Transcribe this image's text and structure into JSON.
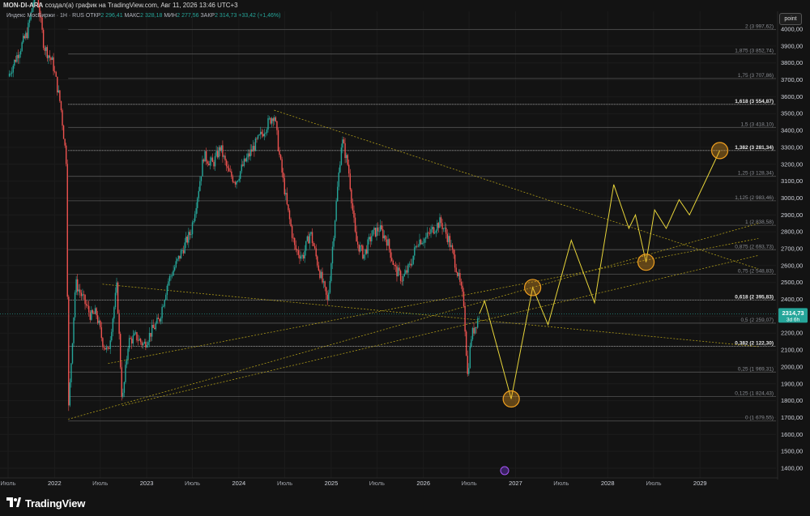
{
  "header": {
    "author": "MON-DI-ARA",
    "created_text": "создал(а) график на TradingView.com, Авг 11, 2026 13:46 UTC+3"
  },
  "legend": {
    "symbol": "Индекс МосБиржи · 1Н · RUS",
    "open_label": "ОТКР",
    "open": "2 296,41",
    "high_label": "МАКС",
    "high": "2 328,18",
    "low_label": "МИН",
    "low": "2 277,56",
    "close_label": "ЗАКР",
    "close": "2 314,73",
    "change": "+33,42 (+1,46%)"
  },
  "scale_button": "point",
  "brand": {
    "name": "TradingView"
  },
  "colors": {
    "background": "#131313",
    "up": "#26a69a",
    "down": "#ef5350",
    "fib": "#9aa0a6",
    "trend": "#c9b21a",
    "forecast": "#e8d53a",
    "marker": "#f0a020"
  },
  "chart_data": {
    "type": "candlestick",
    "price_axis": {
      "min": 1400,
      "max": 4000,
      "ticks": [
        4000,
        3900,
        3800,
        3700,
        3600,
        3500,
        3400,
        3300,
        3200,
        3100,
        3000,
        2900,
        2800,
        2700,
        2600,
        2500,
        2400,
        2300,
        2200,
        2100,
        2000,
        1900,
        1800,
        1700,
        1600,
        1500,
        1400
      ],
      "tick_labels": [
        "4000,00",
        "3900,00",
        "3800,00",
        "3700,00",
        "3600,00",
        "3500,00",
        "3400,00",
        "3300,00",
        "3200,00",
        "3100,00",
        "3000,00",
        "2900,00",
        "2800,00",
        "2700,00",
        "2600,00",
        "2500,00",
        "2400,00",
        "2300,00",
        "2200,00",
        "2100,00",
        "2000,00",
        "1900,00",
        "1800,00",
        "1700,00",
        "1600,00",
        "1500,00",
        "1400,00"
      ]
    },
    "time_axis": {
      "start": "2021-07-01",
      "end": "2029-09-01",
      "labels": [
        {
          "date": "2021-07-01",
          "text": "Июль"
        },
        {
          "date": "2022-01-01",
          "text": "2022"
        },
        {
          "date": "2022-07-01",
          "text": "Июль"
        },
        {
          "date": "2023-01-01",
          "text": "2023"
        },
        {
          "date": "2023-07-01",
          "text": "Июль"
        },
        {
          "date": "2024-01-01",
          "text": "2024"
        },
        {
          "date": "2024-07-01",
          "text": "Июль"
        },
        {
          "date": "2025-01-01",
          "text": "2025"
        },
        {
          "date": "2025-07-01",
          "text": "Июль"
        },
        {
          "date": "2026-01-01",
          "text": "2026"
        },
        {
          "date": "2026-07-01",
          "text": "Июль"
        },
        {
          "date": "2027-01-01",
          "text": "2027"
        },
        {
          "date": "2027-07-01",
          "text": "Июль"
        },
        {
          "date": "2028-01-01",
          "text": "2028"
        },
        {
          "date": "2028-07-01",
          "text": "Июль"
        },
        {
          "date": "2029-01-01",
          "text": "2029"
        }
      ]
    },
    "price_path": [
      [
        "2021-07-01",
        3720
      ],
      [
        "2021-08-10",
        3860
      ],
      [
        "2021-09-15",
        3980
      ],
      [
        "2021-10-20",
        4250
      ],
      [
        "2021-11-20",
        3900
      ],
      [
        "2021-12-25",
        3800
      ],
      [
        "2022-01-25",
        3550
      ],
      [
        "2022-02-18",
        3200
      ],
      [
        "2022-02-24",
        1700
      ],
      [
        "2022-03-25",
        2500
      ],
      [
        "2022-04-25",
        2400
      ],
      [
        "2022-05-25",
        2300
      ],
      [
        "2022-06-15",
        2320
      ],
      [
        "2022-07-10",
        2150
      ],
      [
        "2022-08-01",
        2080
      ],
      [
        "2022-09-05",
        2480
      ],
      [
        "2022-09-26",
        1780
      ],
      [
        "2022-10-20",
        2150
      ],
      [
        "2022-11-20",
        2180
      ],
      [
        "2022-12-20",
        2130
      ],
      [
        "2023-01-20",
        2210
      ],
      [
        "2023-02-20",
        2280
      ],
      [
        "2023-03-25",
        2500
      ],
      [
        "2023-04-25",
        2600
      ],
      [
        "2023-05-25",
        2700
      ],
      [
        "2023-06-25",
        2800
      ],
      [
        "2023-07-25",
        3050
      ],
      [
        "2023-08-15",
        3250
      ],
      [
        "2023-09-20",
        3200
      ],
      [
        "2023-10-20",
        3300
      ],
      [
        "2023-11-20",
        3150
      ],
      [
        "2023-12-20",
        3100
      ],
      [
        "2024-01-20",
        3200
      ],
      [
        "2024-02-20",
        3280
      ],
      [
        "2024-03-20",
        3350
      ],
      [
        "2024-04-20",
        3430
      ],
      [
        "2024-05-20",
        3500
      ],
      [
        "2024-06-10",
        3250
      ],
      [
        "2024-07-10",
        2950
      ],
      [
        "2024-08-10",
        2700
      ],
      [
        "2024-09-10",
        2650
      ],
      [
        "2024-10-10",
        2800
      ],
      [
        "2024-11-10",
        2600
      ],
      [
        "2024-12-18",
        2380
      ],
      [
        "2025-01-10",
        2780
      ],
      [
        "2025-02-12",
        3350
      ],
      [
        "2025-03-10",
        3180
      ],
      [
        "2025-04-08",
        2750
      ],
      [
        "2025-05-10",
        2660
      ],
      [
        "2025-06-10",
        2780
      ],
      [
        "2025-07-10",
        2820
      ],
      [
        "2025-08-10",
        2750
      ],
      [
        "2025-09-10",
        2580
      ],
      [
        "2025-10-10",
        2520
      ],
      [
        "2025-11-10",
        2600
      ],
      [
        "2025-12-10",
        2750
      ],
      [
        "2026-01-10",
        2760
      ],
      [
        "2026-02-10",
        2820
      ],
      [
        "2026-03-10",
        2860
      ],
      [
        "2026-04-10",
        2760
      ],
      [
        "2026-05-10",
        2600
      ],
      [
        "2026-06-10",
        2380
      ],
      [
        "2026-06-25",
        1950
      ],
      [
        "2026-07-10",
        2180
      ],
      [
        "2026-08-11",
        2315
      ]
    ],
    "fib_levels": [
      {
        "ratio": "0",
        "label": "0 (1 679,55)",
        "value": 1679.55
      },
      {
        "ratio": "0.125",
        "label": "0,125 (1 824,43)",
        "value": 1824.43
      },
      {
        "ratio": "0.25",
        "label": "0,25 (1 969,31)",
        "value": 1969.31
      },
      {
        "ratio": "0.382",
        "label": "0,382 (2 122,30)",
        "value": 2122.3,
        "emphasis": true
      },
      {
        "ratio": "0.5",
        "label": "0,5 (2 259,07)",
        "value": 2259.07
      },
      {
        "ratio": "0.618",
        "label": "0,618 (2 395,83)",
        "value": 2395.83,
        "emphasis": true
      },
      {
        "ratio": "0.75",
        "label": "0,75 (2 548,83)",
        "value": 2548.83
      },
      {
        "ratio": "0.875",
        "label": "0,875 (2 693,73)",
        "value": 2693.73
      },
      {
        "ratio": "1",
        "label": "1 (2 838,58)",
        "value": 2838.58
      },
      {
        "ratio": "1.125",
        "label": "1,125 (2 983,46)",
        "value": 2983.46
      },
      {
        "ratio": "1.25",
        "label": "1,25 (3 128,34)",
        "value": 3128.34
      },
      {
        "ratio": "1.382",
        "label": "1,382 (3 281,34)",
        "value": 3281.34,
        "emphasis": true
      },
      {
        "ratio": "1.5",
        "label": "1,5 (3 418,10)",
        "value": 3418.1
      },
      {
        "ratio": "1.618",
        "label": "1,618 (3 554,87)",
        "value": 3554.87,
        "emphasis": true
      },
      {
        "ratio": "1.75",
        "label": "1,75 (3 707,86)",
        "value": 3707.86
      },
      {
        "ratio": "1.875",
        "label": "1,875 (3 852,74)",
        "value": 3852.74
      },
      {
        "ratio": "2",
        "label": "2 (3 997,62)",
        "value": 3997.62
      }
    ],
    "trendlines": [
      {
        "from": [
          "2024-05-20",
          3520
        ],
        "to": [
          "2029-08-20",
          2580
        ]
      },
      {
        "from": [
          "2022-07-10",
          2490
        ],
        "to": [
          "2029-08-20",
          2120
        ]
      },
      {
        "from": [
          "2022-02-24",
          1690
        ],
        "to": [
          "2029-08-20",
          2850
        ]
      },
      {
        "from": [
          "2022-09-26",
          1770
        ],
        "to": [
          "2029-08-20",
          2660
        ]
      },
      {
        "from": [
          "2022-08-01",
          2020
        ],
        "to": [
          "2029-08-20",
          2760
        ]
      }
    ],
    "forecast_path": [
      [
        "2026-08-11",
        2315
      ],
      [
        "2026-09-01",
        2390
      ],
      [
        "2026-12-15",
        1810
      ],
      [
        "2027-03-10",
        2470
      ],
      [
        "2027-05-10",
        2250
      ],
      [
        "2027-08-10",
        2750
      ],
      [
        "2027-11-10",
        2380
      ],
      [
        "2028-01-25",
        3080
      ],
      [
        "2028-03-25",
        2820
      ],
      [
        "2028-04-20",
        2900
      ],
      [
        "2028-06-01",
        2620
      ],
      [
        "2028-07-05",
        2930
      ],
      [
        "2028-08-20",
        2820
      ],
      [
        "2028-10-10",
        2990
      ],
      [
        "2028-11-20",
        2900
      ],
      [
        "2029-03-20",
        3281
      ]
    ],
    "markers": [
      {
        "date": "2026-12-15",
        "price": 1810
      },
      {
        "date": "2027-03-10",
        "price": 2470
      },
      {
        "date": "2028-06-01",
        "price": 2620
      },
      {
        "date": "2029-03-20",
        "price": 3281
      }
    ],
    "last_price": {
      "value": 2314.73,
      "label": "2314,73",
      "countdown": "3d 6h"
    }
  }
}
